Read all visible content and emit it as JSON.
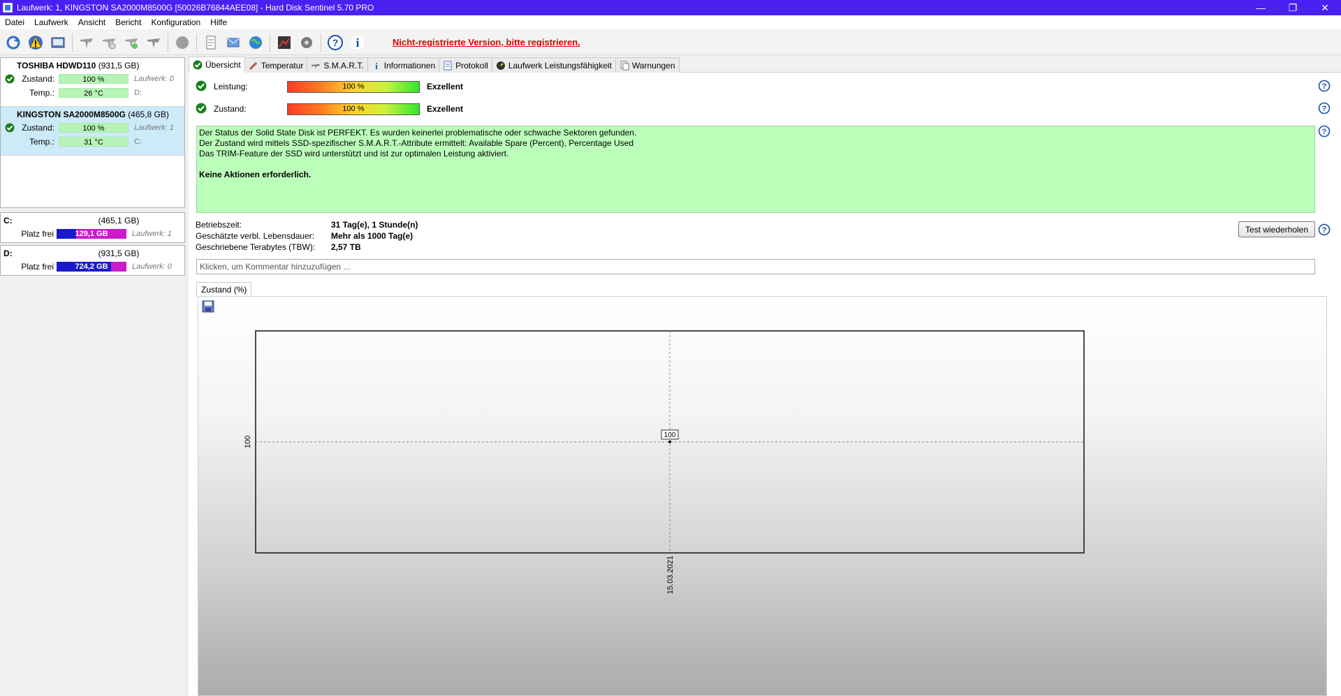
{
  "window": {
    "title": "Laufwerk: 1, KINGSTON SA2000M8500G [50026B76844AEE08]  -  Hard Disk Sentinel 5.70 PRO"
  },
  "menu": [
    "Datei",
    "Laufwerk",
    "Ansicht",
    "Bericht",
    "Konfiguration",
    "Hilfe"
  ],
  "toolbar": {
    "register_text": "Nicht-registrierte Version, bitte registrieren."
  },
  "drives": [
    {
      "name": "TOSHIBA HDWD110",
      "capacity": "(931,5 GB)",
      "health_label": "Zustand:",
      "health": "100 %",
      "drive_ref": "Laufwerk: 0",
      "temp_label": "Temp.:",
      "temp": "26 °C",
      "letters": "D:"
    },
    {
      "name": "KINGSTON SA2000M8500G",
      "capacity": "(465,8 GB)",
      "health_label": "Zustand:",
      "health": "100 %",
      "drive_ref": "Laufwerk: 1",
      "temp_label": "Temp.:",
      "temp": "31 °C",
      "letters": "C:"
    }
  ],
  "volumes": [
    {
      "letter": "C:",
      "capacity": "(465,1 GB)",
      "free_label": "Platz frei",
      "free": "129,1 GB",
      "drive_ref": "Laufwerk: 1",
      "free_fraction": 0.28
    },
    {
      "letter": "D:",
      "capacity": "(931,5 GB)",
      "free_label": "Platz frei",
      "free": "724,2 GB",
      "drive_ref": "Laufwerk: 0",
      "free_fraction": 0.78
    }
  ],
  "tabs": [
    "Übersicht",
    "Temperatur",
    "S.M.A.R.T.",
    "Informationen",
    "Protokoll",
    "Laufwerk Leistungsfähigkeit",
    "Warnungen"
  ],
  "overview": {
    "performance": {
      "label": "Leistung:",
      "value": "100 %",
      "rating": "Exzellent",
      "percent": 100
    },
    "health": {
      "label": "Zustand:",
      "value": "100 %",
      "rating": "Exzellent",
      "percent": 100
    },
    "status_lines": [
      "Der Status der Solid State Disk ist PERFEKT. Es wurden keinerlei problematische oder schwache Sektoren gefunden.",
      "Der Zustand wird mittels SSD-spezifischer S.M.A.R.T.-Attribute ermittelt:  Available Spare (Percent), Percentage Used",
      "Das TRIM-Feature der SSD wird unterstützt und ist zur optimalen Leistung aktiviert."
    ],
    "status_action": "Keine Aktionen erforderlich.",
    "info": [
      {
        "label": "Betriebszeit:",
        "value": "31 Tag(e), 1 Stunde(n)"
      },
      {
        "label": "Geschätzte verbl. Lebensdauer:",
        "value": "Mehr als 1000 Tag(e)"
      },
      {
        "label": "Geschriebene Terabytes (TBW):",
        "value": "2,57 TB"
      }
    ],
    "retest_button": "Test wiederholen",
    "comment_placeholder": "Klicken, um Kommentar hinzuzufügen ...",
    "chart_tab": "Zustand (%)"
  },
  "chart_data": {
    "type": "line",
    "x": [
      "15.03.2021"
    ],
    "series": [
      {
        "values": [
          100
        ]
      }
    ],
    "y_tick_labels": [
      "100"
    ],
    "data_labels": [
      "100"
    ],
    "grid": true
  }
}
